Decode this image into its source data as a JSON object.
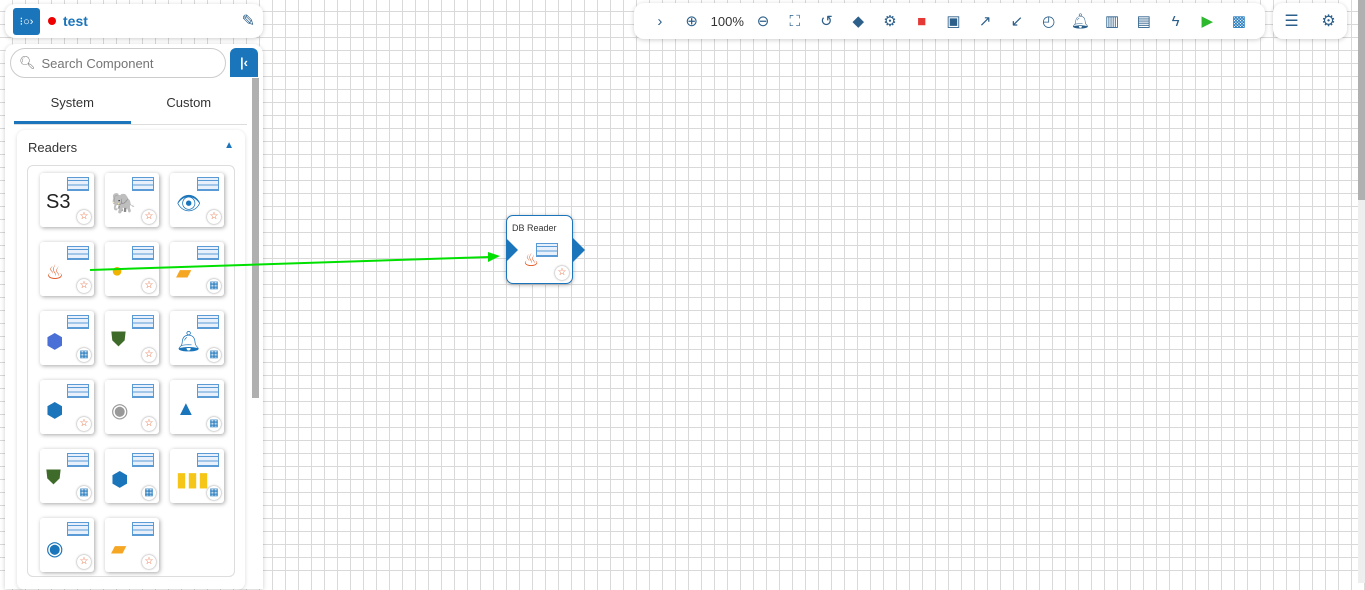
{
  "header": {
    "title": "test"
  },
  "search": {
    "placeholder": "Search Component"
  },
  "tabs": [
    {
      "label": "System"
    },
    {
      "label": "Custom"
    }
  ],
  "section": {
    "title": "Readers"
  },
  "toolbar": {
    "zoom": "100%"
  },
  "node": {
    "label": "DB Reader"
  },
  "colors": {
    "accent": "#1b75bb",
    "connector": "#00e000",
    "delete": "#e53935",
    "run": "#2eb82e"
  },
  "tiles": [
    {
      "icon": "s3-reader",
      "badge": "star"
    },
    {
      "icon": "hdfs-reader",
      "badge": "star"
    },
    {
      "icon": "eye-reader",
      "badge": "star"
    },
    {
      "icon": "db-reader-java",
      "badge": "star"
    },
    {
      "icon": "elastic-reader",
      "badge": "star"
    },
    {
      "icon": "sftp-excel-reader",
      "badge": "docker"
    },
    {
      "icon": "gcs-reader",
      "badge": "docker"
    },
    {
      "icon": "mongodb-reader",
      "badge": "star"
    },
    {
      "icon": "alert-reader",
      "badge": "docker"
    },
    {
      "icon": "binary-reader",
      "badge": "star"
    },
    {
      "icon": "cosmos-reader",
      "badge": "star"
    },
    {
      "icon": "azure-reader",
      "badge": "docker"
    },
    {
      "icon": "mongodb-reader-2",
      "badge": "docker"
    },
    {
      "icon": "binary-reader-2",
      "badge": "docker"
    },
    {
      "icon": "bar-reader",
      "badge": "docker"
    },
    {
      "icon": "cloud-reader",
      "badge": "star"
    },
    {
      "icon": "sftp-reader",
      "badge": "star"
    }
  ]
}
